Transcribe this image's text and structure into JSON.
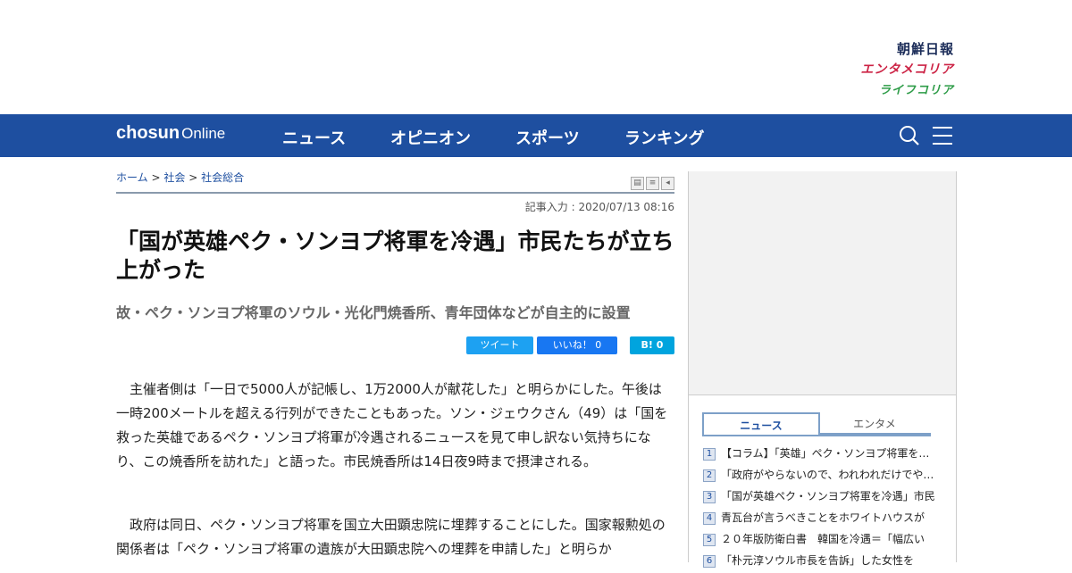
{
  "brand": {
    "line1": "朝鮮日報",
    "line2": "エンタメコリア",
    "line3": "ライフコリア"
  },
  "nav": {
    "logo_main": "chosun",
    "logo_sub": "Online",
    "items": [
      "ニュース",
      "オピニオン",
      "スポーツ",
      "ランキング"
    ],
    "icons": [
      "search-icon",
      "menu-icon"
    ]
  },
  "breadcrumb": {
    "home": "ホーム",
    "sep": ">",
    "cat": "社会",
    "sub": "社会総合"
  },
  "article": {
    "date": "記事入力 : 2020/07/13 08:16",
    "title": "「国が英雄ペク・ソンヨプ将軍を冷遇」市民たちが立ち上がった",
    "subtitle": "故・ペク・ソンヨプ将軍のソウル・光化門焼香所、青年団体などが自主的に設置",
    "share": {
      "tweet": "ツイート",
      "like": "いいね！ 0",
      "hatena": "B! 0"
    },
    "paragraphs": [
      "　主催者側は「一日で5000人が記帳し、1万2000人が献花した」と明らかにした。午後は一時200メートルを超える行列ができたこともあった。ソン・ジェウクさん（49）は「国を救った英雄であるペク・ソンヨプ将軍が冷遇されるニュースを見て申し訳ない気持ちになり、この焼香所を訪れた」と語った。市民焼香所は14日夜9時まで摂津される。",
      "　政府は同日、ペク・ソンヨプ将軍を国立大田顕忠院に埋葬することにした。国家報勲処の関係者は「ペク・ソンヨプ将軍の遺族が大田顕忠院への埋葬を申請した」と明らか"
    ]
  },
  "sidebar": {
    "tabs": [
      "ニュース",
      "エンタメ"
    ],
    "ranking": [
      "【コラム】「英雄」ペク・ソンヨプ将軍を冷遇",
      "「政府がやらないので、われわれだけでやる」",
      "「国が英雄ペク・ソンヨプ将軍を冷遇」市民",
      "青瓦台が言うべきことをホワイトハウスが",
      "２０年版防衛白書　韓国を冷遇＝「幅広い",
      "「朴元淳ソウル市長を告訴」した女性を"
    ]
  }
}
